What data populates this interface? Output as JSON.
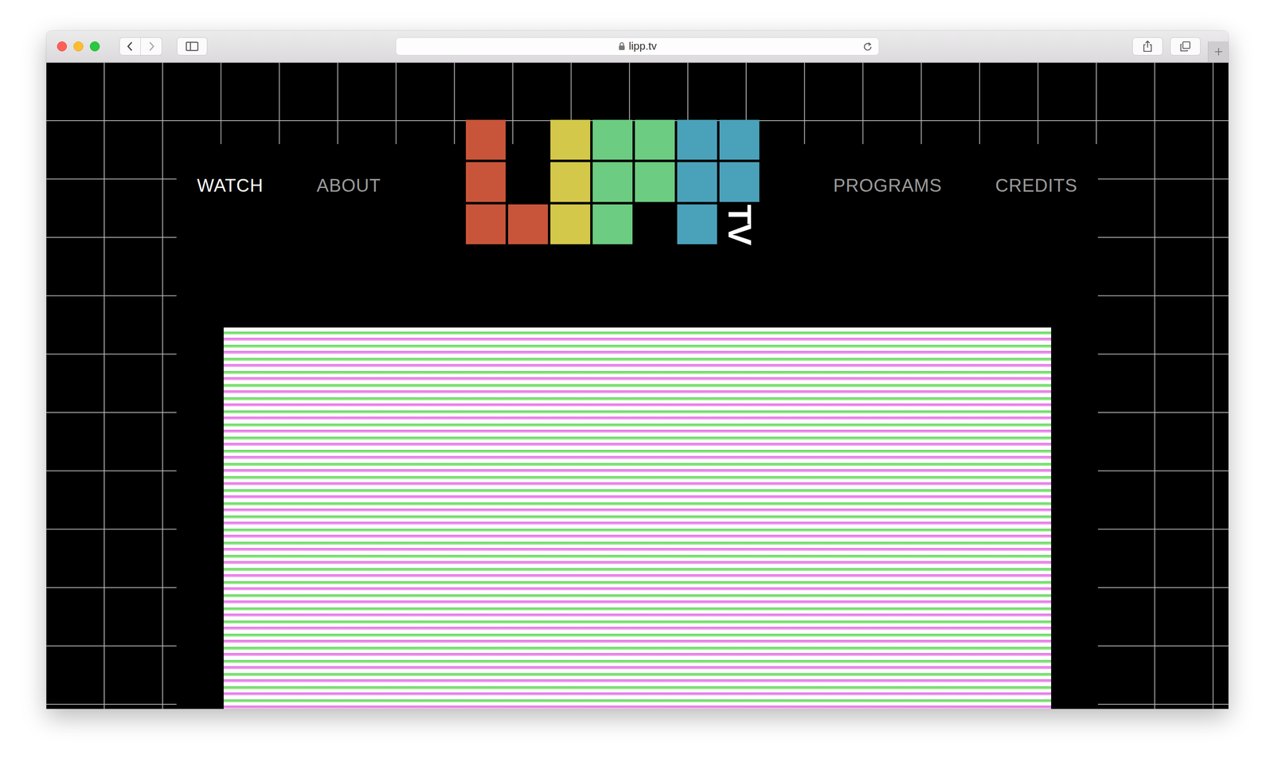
{
  "browser": {
    "url": "lipp.tv"
  },
  "nav": [
    {
      "label": "WATCH",
      "selected": true
    },
    {
      "label": "ABOUT",
      "selected": false
    },
    {
      "label": "PROGRAMS",
      "selected": false
    },
    {
      "label": "CREDITS",
      "selected": false
    }
  ],
  "logo": {
    "text": "TV"
  }
}
